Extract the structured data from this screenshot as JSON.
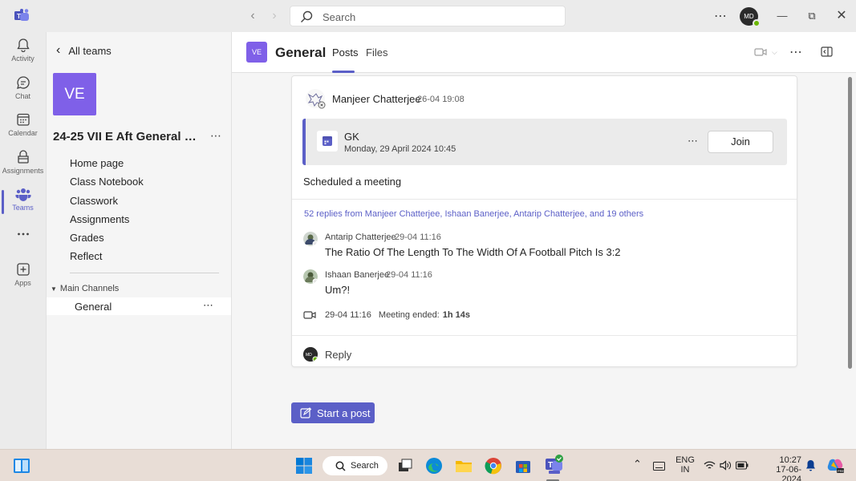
{
  "titlebar": {
    "search_placeholder": "Search",
    "user_initials": "MD"
  },
  "rail": [
    {
      "label": "Activity",
      "icon": "bell-icon"
    },
    {
      "label": "Chat",
      "icon": "chat-icon"
    },
    {
      "label": "Calendar",
      "icon": "calendar-icon"
    },
    {
      "label": "Assignments",
      "icon": "assignments-icon"
    },
    {
      "label": "Teams",
      "icon": "teams-icon",
      "active": true
    },
    {
      "label": "",
      "icon": "more-apps-icon"
    },
    {
      "label": "Apps",
      "icon": "apps-icon"
    }
  ],
  "team": {
    "back_label": "All teams",
    "avatar_initials": "VE",
    "name": "24-25 VII E Aft General Kno...",
    "nav": [
      "Home page",
      "Class Notebook",
      "Classwork",
      "Assignments",
      "Grades",
      "Reflect"
    ],
    "channels_heading": "Main Channels",
    "channel": "General"
  },
  "header": {
    "avatar_initials": "VE",
    "title": "General",
    "tabs": [
      "Posts",
      "Files"
    ]
  },
  "post": {
    "author": "Manjeer Chatterjee",
    "time": "26-04 19:08",
    "meeting": {
      "title": "GK",
      "date": "Monday, 29 April 2024 10:45",
      "join_label": "Join"
    },
    "body": "Scheduled a meeting",
    "replies_summary": "52 replies from Manjeer Chatterjee, Ishaan Banerjee, Antarip Chatterjee, and 19 others",
    "replies": [
      {
        "author": "Antarip Chatterjee",
        "time": "29-04 11:16",
        "text": "The Ratio Of The Length To The Width Of A Football Pitch Is 3:2"
      },
      {
        "author": "Ishaan Banerjee",
        "time": "29-04 11:16",
        "text": "Um?!"
      }
    ],
    "meeting_ended": {
      "time": "29-04 11:16",
      "label": "Meeting ended:",
      "duration": "1h 14s"
    },
    "reply_label": "Reply"
  },
  "start_post_label": "Start a post",
  "taskbar": {
    "search_label": "Search",
    "lang_line1": "ENG",
    "lang_line2": "IN",
    "time": "10:27",
    "date": "17-06-2024"
  },
  "colors": {
    "accent": "#5b5fc7",
    "team_avatar": "#7f60e8"
  }
}
